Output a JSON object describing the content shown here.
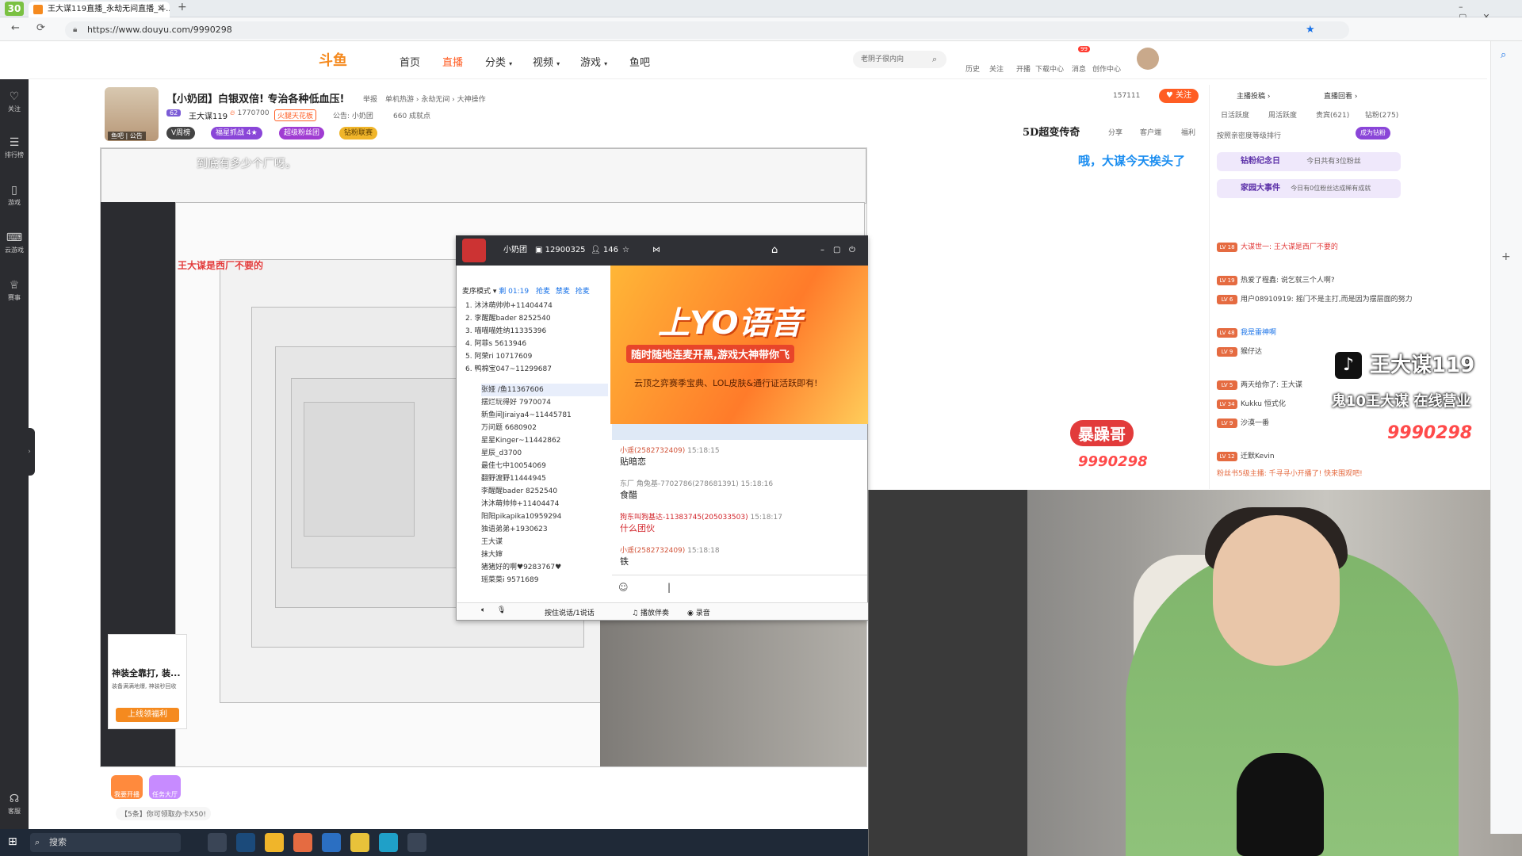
{
  "browser": {
    "tab_title": "王大谋119直播_永劫无间直播_斗...",
    "url": "https://www.douyu.com/9990298"
  },
  "site": {
    "logo": "斗鱼",
    "nav": [
      "首页",
      "直播",
      "分类",
      "视频",
      "游戏",
      "鱼吧"
    ],
    "search_placeholder": "老阴子很内向",
    "header_icons": [
      "历史",
      "关注",
      "开播",
      "下载中心",
      "消息",
      "创作中心"
    ],
    "msg_badge": "99"
  },
  "leftrail": [
    "关注",
    "排行榜",
    "游戏",
    "云游戏",
    "赛事",
    "客服"
  ],
  "stream": {
    "title": "【小奶团】白银双倍! 专治各种低血压!",
    "tag_report": "举报",
    "breadcrumb": "单机热游 › 永劫无间 › 大神操作",
    "level": "62",
    "name": "王大谋119",
    "heat": "1770700",
    "badge_flower": "火腿天花板",
    "notice": "公告: 小奶团",
    "fans": "660 成就点",
    "pills": [
      "V周榜",
      "福星抓战 4★",
      "超级粉丝团",
      "钻粉联赛"
    ],
    "follow_count": "157111",
    "follow_label": "关注",
    "promo": "5D超变传奇",
    "actions": [
      "分享",
      "客户端",
      "福利"
    ],
    "avatar_tag": "鱼吧 | 公告"
  },
  "overlays": {
    "topleft": "到底有多少个厂呀。",
    "topright": "哦，大谋今天挨头了",
    "nested_banner": "王大谋是西厂不要的",
    "name": "王大谋119",
    "sub": "鬼10王大谋 在线营业",
    "number": "9990298",
    "baozi": "暴躁哥",
    "baozi_num": "9990298"
  },
  "chatwin": {
    "group_name": "小奶团",
    "group_id": "12900325",
    "members": "146",
    "mode": "麦序模式",
    "timer": "01:19",
    "actions": [
      "抢麦",
      "禁麦",
      "抢麦"
    ],
    "users": [
      "1. 沐沐萌帅帅+11404474",
      "2. 李醒醒bader 8252540",
      "3. 喵喵喵姓纳11335396",
      "4. 阿菲s 5613946",
      "5. 阿荣ri 10717609",
      "6. 鸭棉宝047~11299687",
      "张娅 /鱼11367606",
      "摆烂玩得好 7970074",
      "新鱼间Jiraiya4~11445781",
      "万问题 6680902",
      "星星Kinger~11442862",
      "星辰_d3700",
      "最佳七中10054069",
      "翻野渡野11444945",
      "李醒醒bader 8252540",
      "沐沐萌帅帅+11404474",
      "阳阳pikapika10959294",
      "独语弟弟+1930623",
      "王大谋",
      "抹大婶",
      "猪猪好的啊♥9283767♥",
      "瑶菜菜i 9571689"
    ],
    "banner_title": "上YO语音",
    "banner_sub": "随时随地连麦开黑,游戏大神带你飞",
    "banner_foot": "云顶之弈赛季宝典、LOL皮肤&通行证活跃即有!",
    "messages": [
      {
        "name": "小遥(2582732409)",
        "time": "15:18:15",
        "text": "贴暗恋"
      },
      {
        "name": "东厂 角兔基-7702786(278681391)",
        "time": "15:18:16",
        "text": "食醋"
      },
      {
        "name": "狗东叫狗基达-11383745(205033503)",
        "time": "15:18:17",
        "text": "什么团伙"
      },
      {
        "name": "小遥(2582732409)",
        "time": "15:18:18",
        "text": "铁"
      }
    ],
    "bottom": [
      "按住说话/1说话",
      "播放伴奏",
      "录音"
    ]
  },
  "rightpanel": {
    "tabs_top": [
      "主播投稿",
      "直播回看"
    ],
    "tabs": [
      "日活跃度",
      "周活跃度",
      "贵宾(621)",
      "钻粉(275)"
    ],
    "rank_label": "按照亲密度等级排行",
    "become_fan": "成为钻粉",
    "card1": "钻粉纪念日",
    "card1_sub": "今日共有3位粉丝",
    "card2": "家园大事件",
    "card2_sub": "今日有0位粉丝达成稀有成就",
    "msgs": [
      {
        "lv": "LV 18",
        "text": "大谋世一: 王大谋是西厂不要的"
      },
      {
        "lv": "LV 19",
        "text": "热爱了程鑫: 说乞就三个人啊?"
      },
      {
        "lv": "LV 6",
        "text": "用户08910919: 摇门不是主打,而是因为摆层面的努力"
      },
      {
        "lv": "LV 48",
        "text": "我是雷神啊"
      },
      {
        "lv": "LV 9",
        "text": "猴仔达"
      },
      {
        "lv": "LV 5",
        "text": "两天给你了: 王大谋"
      },
      {
        "lv": "LV 34",
        "text": "Kukku 恒式化"
      },
      {
        "lv": "LV 9",
        "text": "沙漠一番"
      },
      {
        "lv": "LV 12",
        "text": "迁默Kevin"
      }
    ],
    "system": "粉丝书5级主播: 千寻寻小开播了! 快来围观吧!"
  },
  "bottombar": {
    "btn1": "我要开播",
    "btn2": "任务大厅",
    "notice": "【5条】你可领取办卡X50!"
  },
  "ad": {
    "title": "神装全靠打, 装...",
    "sub": "装备满满地爆, 神装秒回收",
    "btn": "上线领福利"
  },
  "taskbar": {
    "search": "搜索"
  },
  "colors": {
    "accent": "#ff5d23",
    "douyu_orange": "#f58a1f",
    "hoodie": "#8fc27a"
  }
}
